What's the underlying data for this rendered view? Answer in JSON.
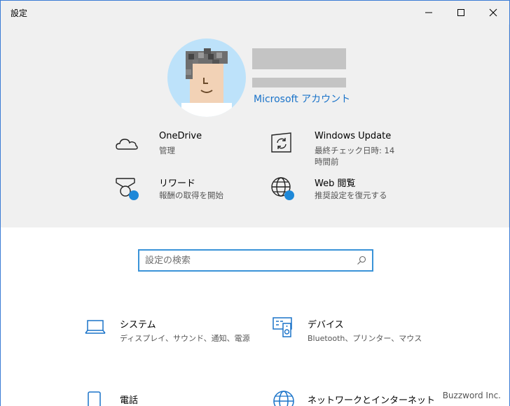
{
  "window": {
    "title": "設定",
    "controls": {
      "minimize_icon": "minimize-icon",
      "maximize_icon": "maximize-icon",
      "close_icon": "close-icon"
    }
  },
  "account": {
    "link_label": "Microsoft アカウント"
  },
  "quick_links": [
    {
      "title": "OneDrive",
      "subtitle": "管理",
      "icon": "cloud-icon"
    },
    {
      "title": "Windows Update",
      "subtitle": "最終チェック日時: 14 時間前",
      "icon": "refresh-icon"
    },
    {
      "title": "リワード",
      "subtitle": "報酬の取得を開始",
      "icon": "medal-icon"
    },
    {
      "title": "Web 閲覧",
      "subtitle": "推奨設定を復元する",
      "icon": "globe-icon"
    }
  ],
  "search": {
    "placeholder": "設定の検索"
  },
  "categories": [
    {
      "title": "システム",
      "subtitle": "ディスプレイ、サウンド、通知、電源",
      "icon": "laptop-icon"
    },
    {
      "title": "デバイス",
      "subtitle": "Bluetooth、プリンター、マウス",
      "icon": "devices-icon"
    },
    {
      "title": "電話",
      "subtitle": "",
      "icon": "phone-icon"
    },
    {
      "title": "ネットワークとインターネット",
      "subtitle": "",
      "icon": "globe-icon"
    }
  ],
  "watermark": "Buzzword Inc.",
  "colors": {
    "accent": "#1a73c9",
    "header_bg": "#f0f0f0",
    "badge": "#1e88d8",
    "search_border": "#3a93d8"
  }
}
